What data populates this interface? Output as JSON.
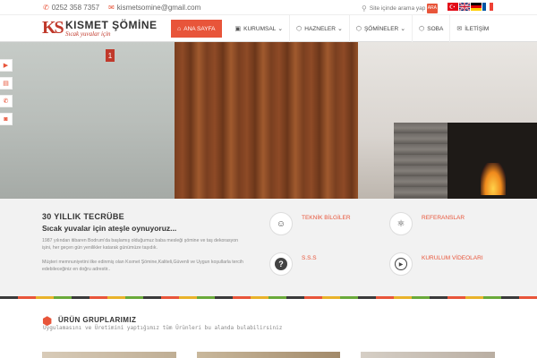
{
  "topbar": {
    "phone": "0252 358 7357",
    "email": "kismetsomine@gmail.com",
    "search_placeholder": "Site içinde arama yap",
    "search_button": "ARA"
  },
  "logo": {
    "mark": "KS",
    "name": "KISMET ŞÖMİNE",
    "slogan": "Sıcak yuvalar için"
  },
  "nav": [
    {
      "label": "ANA SAYFA",
      "icon": "home-icon"
    },
    {
      "label": "KURUMSAL",
      "icon": "user-icon",
      "dropdown": true
    },
    {
      "label": "HAZNELER",
      "icon": "cube-icon",
      "dropdown": true
    },
    {
      "label": "ŞÖMİNELER",
      "icon": "cube-icon",
      "dropdown": true
    },
    {
      "label": "SOBA",
      "icon": "cube-icon"
    },
    {
      "label": "İLETİŞİM",
      "icon": "mail-icon"
    }
  ],
  "hero": {
    "slide_number": "1"
  },
  "info": {
    "heading": "30 YILLIK TECRÜBE",
    "subheading": "Sıcak yuvalar için ateşle oynuyoruz...",
    "para1": "1987 yılından itibaren Bodrum'da başlamış olduğumuz baba mesleği şömine ve taş dekorasyon işini, her geçen gün yenilikler katarak günümüze taşıdık.",
    "para2": "Müşteri memnuniyetini ilke edinmiş olan Kısmet Şömine,Kaliteli,Güvenli ve Uygun koşullarla tercih edebileceğiniz en doğru adrestir..",
    "features": [
      {
        "label": "TEKNİK BİLGİLER",
        "icon": "user-circle-icon"
      },
      {
        "label": "REFERANSLAR",
        "icon": "atom-icon"
      },
      {
        "label": "S.S.S",
        "icon": "question-icon"
      },
      {
        "label": "KURULUM VİDEOLARI",
        "icon": "play-icon"
      }
    ]
  },
  "products": {
    "title": "ÜRÜN GRUPLARIMIZ",
    "subtitle": "Uygulamasını ve Üretimini yaptığımız tüm Ürünleri bu alanda bulabilirsiniz"
  },
  "colors": {
    "accent": "#e8553a",
    "brand_red": "#c0392b",
    "info_bg": "#f2f2f2"
  }
}
